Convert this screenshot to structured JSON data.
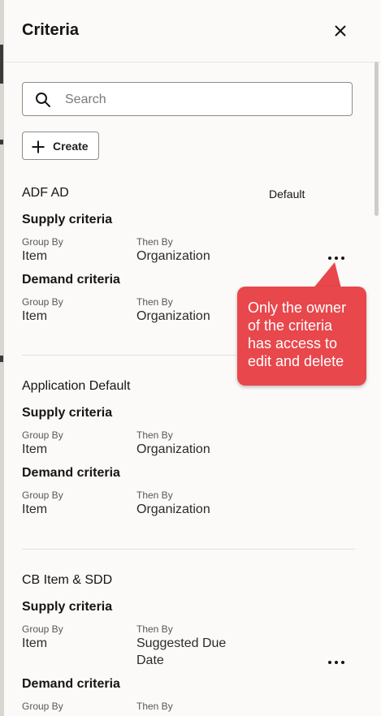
{
  "panel": {
    "title": "Criteria"
  },
  "search": {
    "placeholder": "Search"
  },
  "toolbar": {
    "create_label": "Create"
  },
  "callout": {
    "text": "Only the owner of the criteria has access to edit and delete",
    "color": "#e8474c"
  },
  "criteria": [
    {
      "name": "ADF AD",
      "badge": "Default",
      "supply": {
        "heading": "Supply criteria",
        "group_by_label": "Group By",
        "group_by": "Item",
        "then_by_label": "Then By",
        "then_by": "Organization"
      },
      "demand": {
        "heading": "Demand criteria",
        "group_by_label": "Group By",
        "group_by": "Item",
        "then_by_label": "Then By",
        "then_by": "Organization"
      }
    },
    {
      "name": "Application Default",
      "supply": {
        "heading": "Supply criteria",
        "group_by_label": "Group By",
        "group_by": "Item",
        "then_by_label": "Then By",
        "then_by": "Organization"
      },
      "demand": {
        "heading": "Demand criteria",
        "group_by_label": "Group By",
        "group_by": "Item",
        "then_by_label": "Then By",
        "then_by": "Organization"
      }
    },
    {
      "name": "CB Item & SDD",
      "supply": {
        "heading": "Supply criteria",
        "group_by_label": "Group By",
        "group_by": "Item",
        "then_by_label": "Then By",
        "then_by_line1": "Suggested Due",
        "then_by_line2": "Date"
      },
      "demand": {
        "heading": "Demand criteria",
        "group_by_label": "Group By",
        "then_by_label": "Then By"
      }
    }
  ]
}
